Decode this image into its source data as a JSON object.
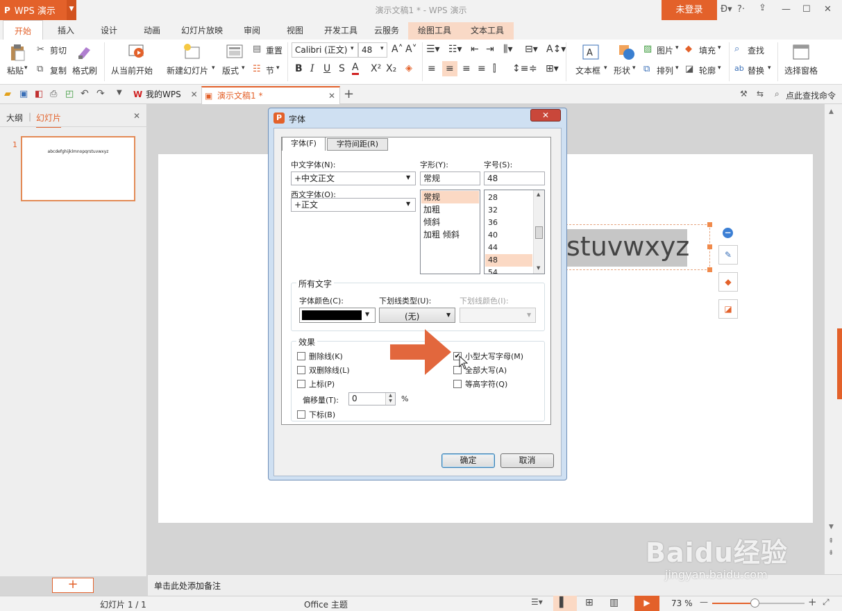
{
  "app": {
    "logo_glyph": "P",
    "name": "WPS 演示",
    "brand_color": "#e3612a"
  },
  "window": {
    "title": "演示文稿1 * - WPS 演示",
    "login": "未登录"
  },
  "menu_tabs": [
    "开始",
    "插入",
    "设计",
    "动画",
    "幻灯片放映",
    "审阅",
    "视图",
    "开发工具",
    "云服务",
    "绘图工具",
    "文本工具"
  ],
  "ribbon": {
    "paste": "粘贴",
    "cut": "剪切",
    "copy": "复制",
    "format_painter": "格式刷",
    "from_current": "从当前开始",
    "new_slide": "新建幻灯片",
    "layout": "版式",
    "reset": "重置",
    "section": "节",
    "font_name": "Calibri (正文)",
    "font_size": "48",
    "textbox": "文本框",
    "shape": "形状",
    "picture": "图片",
    "arrange": "排列",
    "fill": "填充",
    "outline": "轮廓",
    "find": "查找",
    "replace": "替换",
    "selection_pane": "选择窗格"
  },
  "doc_tabs": {
    "my_wps": "我的WPS",
    "doc": "演示文稿1 *"
  },
  "search_cmd": "点此查找命令",
  "left_panel": {
    "tab_outline": "大纲",
    "tab_slides": "幻灯片",
    "slide_number": "1",
    "thumb_text": "abcdefghijklmnopqrstuvwxyz"
  },
  "slide": {
    "visible_text": "stuvwxyz"
  },
  "notes_placeholder": "单击此处添加备注",
  "status": {
    "slide_info": "幻灯片 1 / 1",
    "theme": "Office 主题",
    "zoom": "73 %",
    "zoom_level": 0.46
  },
  "dialog": {
    "title": "字体",
    "tab_font": "字体(F)",
    "tab_spacing": "字符间距(R)",
    "cn_font_label": "中文字体(N):",
    "cn_font_value": "+中文正文",
    "west_font_label": "西文字体(O):",
    "west_font_value": "+正文",
    "style_label": "字形(Y):",
    "style_value": "常规",
    "styles": [
      "常规",
      "加粗",
      "倾斜",
      "加粗 倾斜"
    ],
    "size_label": "字号(S):",
    "size_value": "48",
    "sizes": [
      "28",
      "32",
      "36",
      "40",
      "44",
      "48",
      "54"
    ],
    "all_text": "所有文字",
    "font_color_label": "字体颜色(C):",
    "font_color": "#000000",
    "underline_type_label": "下划线类型(U):",
    "underline_type_value": "(无)",
    "underline_color_label": "下划线颜色(I):",
    "effects": "效果",
    "strikethrough": "删除线(K)",
    "double_strikethrough": "双删除线(L)",
    "superscript": "上标(P)",
    "offset_label": "偏移量(T):",
    "offset_value": "0",
    "offset_unit": "%",
    "subscript": "下标(B)",
    "small_caps": "小型大写字母(M)",
    "all_caps": "全部大写(A)",
    "equalize": "等高字符(Q)",
    "small_caps_checked": true,
    "ok": "确定",
    "cancel": "取消"
  },
  "watermark": {
    "brand": "Baidu经验",
    "url": "jingyan.baidu.com"
  }
}
